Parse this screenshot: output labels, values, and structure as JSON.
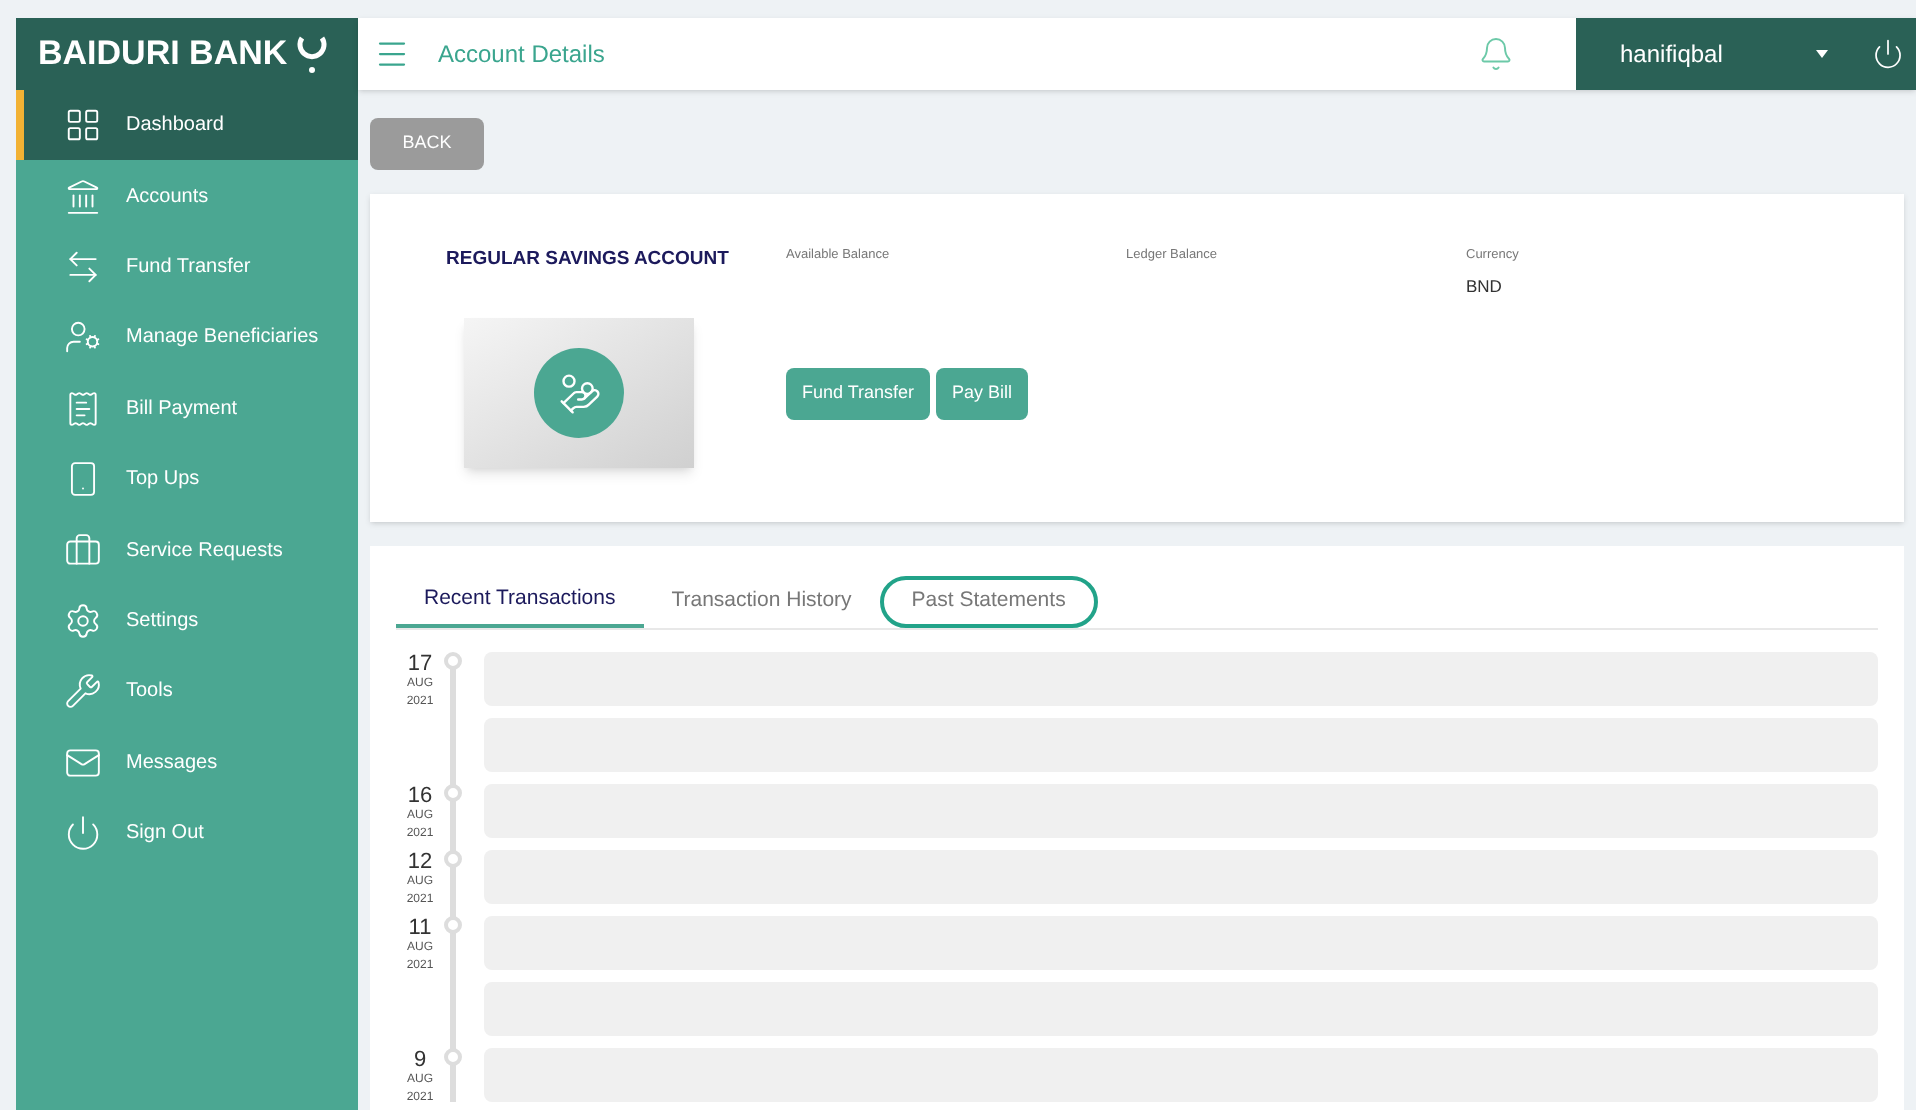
{
  "brand": "BAIDURI BANK",
  "header": {
    "title": "Account Details",
    "user": "hanifiqbal"
  },
  "sidebar": {
    "items": [
      {
        "label": "Dashboard",
        "selected": true
      },
      {
        "label": "Accounts",
        "selected": false
      },
      {
        "label": "Fund Transfer",
        "selected": false
      },
      {
        "label": "Manage Beneficiaries",
        "selected": false
      },
      {
        "label": "Bill Payment",
        "selected": false
      },
      {
        "label": "Top Ups",
        "selected": false
      },
      {
        "label": "Service Requests",
        "selected": false
      },
      {
        "label": "Settings",
        "selected": false
      },
      {
        "label": "Tools",
        "selected": false
      },
      {
        "label": "Messages",
        "selected": false
      },
      {
        "label": "Sign Out",
        "selected": false
      }
    ]
  },
  "back_button": "BACK",
  "account": {
    "name": "REGULAR SAVINGS ACCOUNT",
    "fields": [
      {
        "label": "Available Balance"
      },
      {
        "label": "Ledger Balance"
      },
      {
        "label": "Currency",
        "value": "BND"
      }
    ],
    "buttons": [
      "Fund Transfer",
      "Pay Bill"
    ]
  },
  "tabs": [
    {
      "label": "Recent Transactions",
      "selected": true,
      "highlighted": false
    },
    {
      "label": "Transaction History",
      "selected": false,
      "highlighted": false
    },
    {
      "label": "Past Statements",
      "selected": false,
      "highlighted": true
    }
  ],
  "transactions": [
    {
      "day": "17",
      "month": "AUG",
      "year": "2021",
      "entries": [
        {
          "kind": "placeholder"
        },
        {
          "kind": "placeholder"
        }
      ]
    },
    {
      "day": "16",
      "month": "AUG",
      "year": "2021",
      "entries": [
        {
          "kind": "placeholder"
        }
      ]
    },
    {
      "day": "12",
      "month": "AUG",
      "year": "2021",
      "entries": [
        {
          "kind": "placeholder"
        }
      ]
    },
    {
      "day": "11",
      "month": "AUG",
      "year": "2021",
      "entries": [
        {
          "kind": "placeholder"
        },
        {
          "kind": "placeholder"
        }
      ]
    },
    {
      "day": "9",
      "month": "AUG",
      "year": "2021",
      "entries": [
        {
          "kind": "placeholder"
        }
      ]
    }
  ]
}
